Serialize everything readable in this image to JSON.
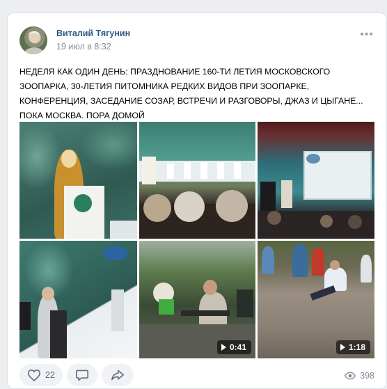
{
  "post": {
    "author": "Виталий Тягунин",
    "date": "19 июл в 8:32",
    "more_label": "•••",
    "text": "НЕДЕЛЯ КАК ОДИН ДЕНЬ: ПРАЗДНОВАНИЕ 160-ТИ ЛЕТИЯ МОСКОВСКОГО ЗООПАРКА, 30-ЛЕТИЯ ПИТОМНИКА РЕДКИХ ВИДОВ ПРИ ЗООПАРКЕ, КОНФЕРЕНЦИЯ, ЗАСЕДАНИЕ СОЗАР, ВСТРЕЧИ И РАЗГОВОРЫ, ДЖАЗ И ЦЫГАНЕ... ПОКА МОСКВА. ПОРА ДОМОЙ"
  },
  "media": {
    "video1_duration": "0:41",
    "video2_duration": "1:18"
  },
  "actions": {
    "likes": "22",
    "views": "398"
  },
  "icons": {
    "like": "heart-icon",
    "comment": "comment-icon",
    "share": "share-icon",
    "views": "eye-icon",
    "play": "play-icon"
  },
  "colors": {
    "author": "#2a5885",
    "meta": "#818c99",
    "background": "#edeef0"
  }
}
